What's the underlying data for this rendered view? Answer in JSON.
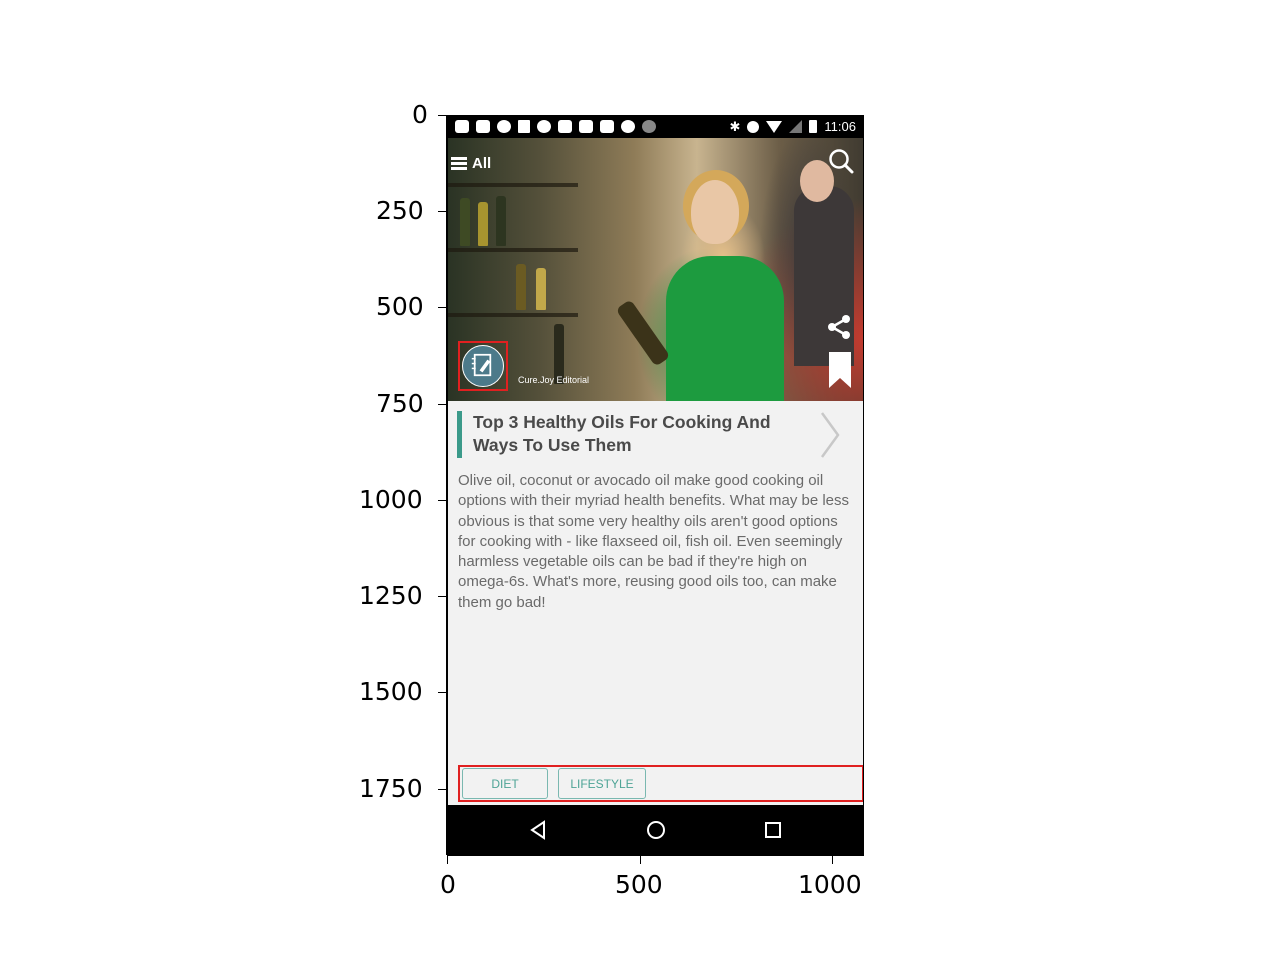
{
  "axes": {
    "y_ticks": [
      "0",
      "250",
      "500",
      "750",
      "1000",
      "1250",
      "1500",
      "1750"
    ],
    "x_ticks": [
      "0",
      "500",
      "1000"
    ]
  },
  "status_bar": {
    "time": "11:06",
    "left_icons": [
      "message-icon",
      "facebook-icon",
      "stopwatch-icon",
      "wrench-icon",
      "smiley-icon",
      "facebook-icon",
      "outlook-icon",
      "chinese-app-icon",
      "smiley-icon",
      "info-icon"
    ],
    "right_icons": [
      "bluetooth-icon",
      "alarm-icon",
      "wifi-icon",
      "signal-icon",
      "battery-charging-icon"
    ]
  },
  "header": {
    "menu_label": "All"
  },
  "hero": {
    "author_name": "Cure.Joy Editorial"
  },
  "article": {
    "title": "Top 3 Healthy Oils For Cooking And Ways To Use Them",
    "summary": "Olive oil, coconut or avocado oil make good cooking oil options with their myriad health benefits. What may be less obvious is that some very healthy oils aren't good options for cooking with - like flaxseed oil, fish oil. Even seemingly harmless vegetable oils can be bad if they're high on omega-6s. What's more, reusing good oils too, can make them go bad!"
  },
  "tags": [
    "DIET",
    "LIFESTYLE"
  ],
  "colors": {
    "accent": "#3b9a8a",
    "highlight": "#e02020",
    "tag_text": "#4ea496",
    "background": "#f2f2f2"
  }
}
